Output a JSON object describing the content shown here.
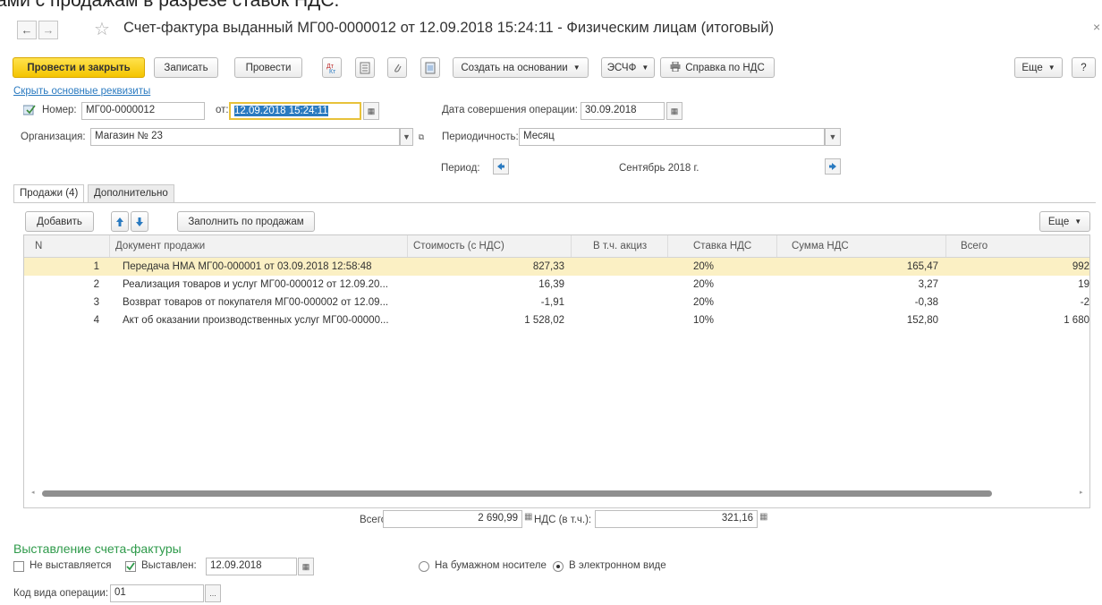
{
  "cropped_caption": "ами с продажам в разрезе ставок НДС.",
  "window": {
    "title": "Счет-фактура выданный МГ00-0000012 от 12.09.2018 15:24:11 - Физическим лицам (итоговый)",
    "close_symbol": "×",
    "back_symbol": "←",
    "forward_symbol": "→",
    "star_symbol": "☆"
  },
  "toolbar": {
    "post_close": "Провести и закрыть",
    "save": "Записать",
    "post": "Провести",
    "create_based": "Создать на основании",
    "esf": "ЭСЧФ",
    "vat_help": "Справка по НДС",
    "more": "Еще",
    "help": "?"
  },
  "header": {
    "hide_link": "Скрыть основные реквизиты",
    "number_label": "Номер:",
    "number_value": "МГ00-0000012",
    "from_label": "от:",
    "date_value": "12.09.2018 15:24:11",
    "operation_date_label": "Дата совершения операции:",
    "operation_date_value": "30.09.2018",
    "org_label": "Организация:",
    "org_value": "Магазин № 23",
    "periodicity_label": "Периодичность:",
    "periodicity_value": "Месяц",
    "period_label": "Период:",
    "period_value": "Сентябрь 2018 г."
  },
  "tabs": [
    {
      "label": "Продажи (4)"
    },
    {
      "label": "Дополнительно"
    }
  ],
  "grid_toolbar": {
    "add": "Добавить",
    "fill": "Заполнить по продажам",
    "more": "Еще"
  },
  "columns": [
    "N",
    "Документ продажи",
    "Стоимость (с НДС)",
    "В т.ч. акциз",
    "Ставка НДС",
    "Сумма НДС",
    "Всего"
  ],
  "rows": [
    {
      "n": "1",
      "doc": "Передача НМА МГ00-000001 от 03.09.2018 12:58:48",
      "cost": "827,33",
      "excise": "",
      "rate": "20%",
      "vat": "165,47",
      "total": "992"
    },
    {
      "n": "2",
      "doc": "Реализация товаров и услуг МГ00-000012 от 12.09.20...",
      "cost": "16,39",
      "excise": "",
      "rate": "20%",
      "vat": "3,27",
      "total": "19"
    },
    {
      "n": "3",
      "doc": "Возврат товаров от покупателя МГ00-000002 от 12.09...",
      "cost": "-1,91",
      "excise": "",
      "rate": "20%",
      "vat": "-0,38",
      "total": "-2"
    },
    {
      "n": "4",
      "doc": "Акт об оказании производственных услуг МГ00-00000...",
      "cost": "1 528,02",
      "excise": "",
      "rate": "10%",
      "vat": "152,80",
      "total": "1 680"
    }
  ],
  "totals": {
    "total_label": "Всего:",
    "total_value": "2 690,99",
    "vat_label": "НДС (в т.ч.):",
    "vat_value": "321,16"
  },
  "invoice": {
    "section_title": "Выставление счета-фактуры",
    "not_issued": "Не выставляется",
    "issued": "Выставлен:",
    "issued_date": "12.09.2018",
    "paper": "На бумажном носителе",
    "electronic": "В электронном виде",
    "op_code_label": "Код вида операции:",
    "op_code_value": "01",
    "dots": "..."
  },
  "colors": {
    "accent_yellow": "#f4c400",
    "selected_row": "#fbf0c4",
    "link_blue": "#2a7ac0",
    "section_green": "#2e9a4a"
  }
}
